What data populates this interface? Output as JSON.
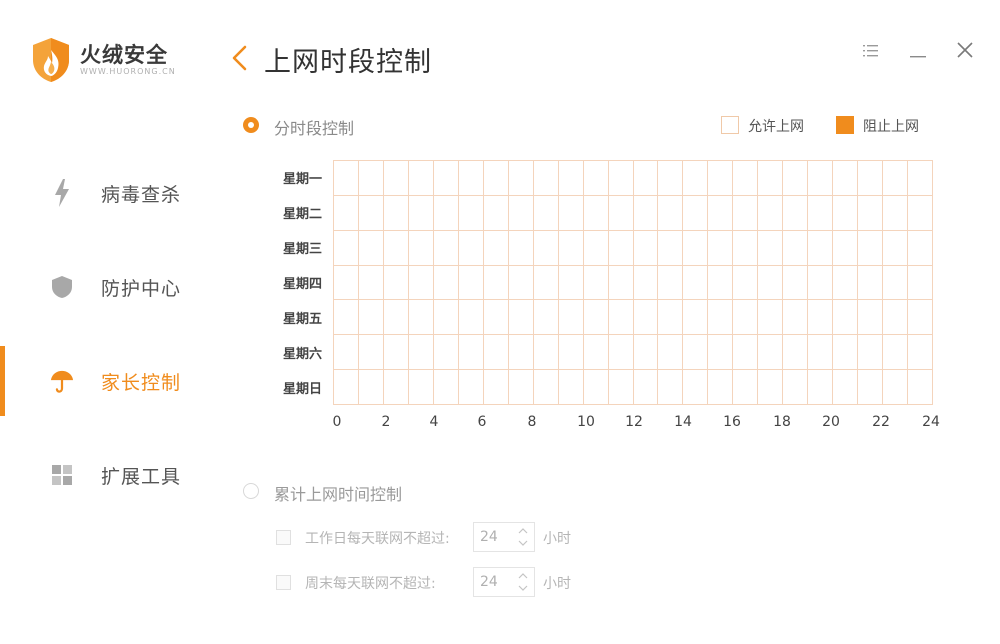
{
  "brand": {
    "name": "火绒安全",
    "url": "WWW.HUORONG.CN"
  },
  "nav": {
    "items": [
      {
        "label": "病毒查杀",
        "icon": "lightning-icon"
      },
      {
        "label": "防护中心",
        "icon": "shield-icon"
      },
      {
        "label": "家长控制",
        "icon": "umbrella-icon",
        "active": true
      },
      {
        "label": "扩展工具",
        "icon": "grid-icon"
      }
    ]
  },
  "header": {
    "title": "上网时段控制"
  },
  "schedule": {
    "option_label": "分时段控制",
    "selected": true,
    "legend": {
      "allow": "允许上网",
      "block": "阻止上网"
    },
    "days": [
      "星期一",
      "星期二",
      "星期三",
      "星期四",
      "星期五",
      "星期六",
      "星期日"
    ],
    "hour_ticks": [
      "0",
      "2",
      "4",
      "6",
      "8",
      "10",
      "12",
      "14",
      "16",
      "18",
      "20",
      "22",
      "24"
    ]
  },
  "cumulative": {
    "option_label": "累计上网时间控制",
    "selected": false,
    "weekday": {
      "label": "工作日每天联网不超过:",
      "value": "24",
      "unit": "小时"
    },
    "weekend": {
      "label": "周末每天联网不超过:",
      "value": "24",
      "unit": "小时"
    }
  },
  "colors": {
    "accent": "#f08c1d",
    "grid_line": "#f4d4bc",
    "block": "#f08c1d"
  }
}
